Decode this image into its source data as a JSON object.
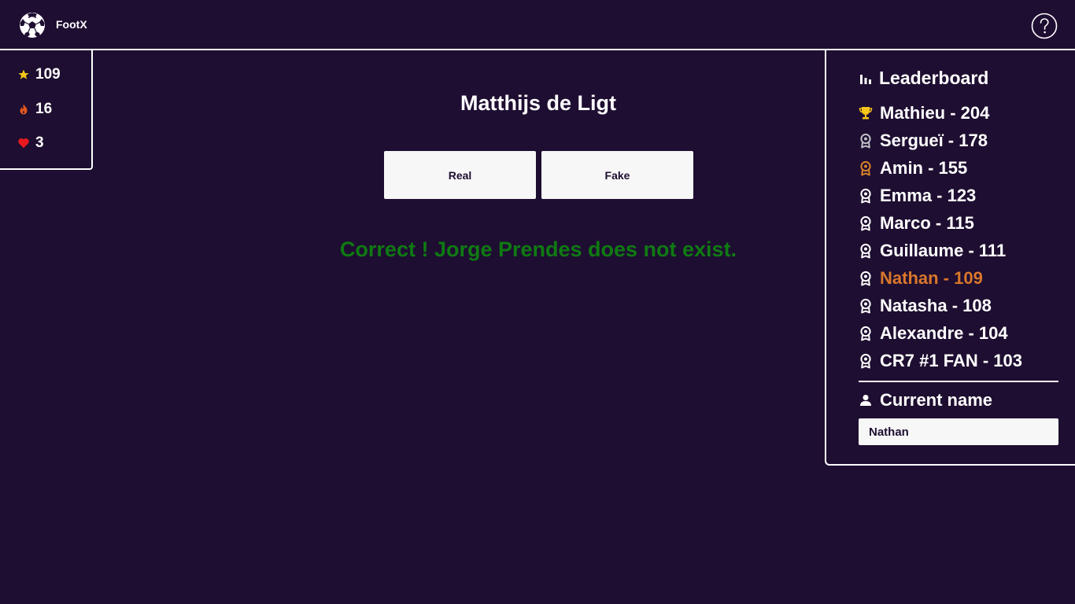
{
  "app": {
    "title": "FootX",
    "logo_icon": "soccer-ball-icon",
    "help_icon": "help-circle-icon"
  },
  "stats": [
    {
      "icon": "star-icon",
      "value": "109",
      "color": "#f5c518"
    },
    {
      "icon": "flame-icon",
      "value": "16",
      "color": "#e2571c"
    },
    {
      "icon": "heart-icon",
      "value": "3",
      "color": "#e8191e"
    }
  ],
  "game": {
    "player_name": "Matthijs de Ligt",
    "real_label": "Real",
    "fake_label": "Fake",
    "result_text": "Correct ! Jorge Prendes does not exist.",
    "result_color": "#0f7a12"
  },
  "leaderboard": {
    "title": "Leaderboard",
    "title_icon": "bar-chart-icon",
    "entries": [
      {
        "text": "Mathieu - 204",
        "icon": "trophy-icon",
        "icon_color": "#f5c518"
      },
      {
        "text": "Sergueï - 178",
        "icon": "medal-icon",
        "icon_color": "#c0c0c8"
      },
      {
        "text": "Amin - 155",
        "icon": "medal-icon",
        "icon_color": "#d9822b"
      },
      {
        "text": "Emma - 123",
        "icon": "medal-icon",
        "icon_color": "#ffffff"
      },
      {
        "text": "Marco - 115",
        "icon": "medal-icon",
        "icon_color": "#ffffff"
      },
      {
        "text": "Guillaume - 111",
        "icon": "medal-icon",
        "icon_color": "#ffffff"
      },
      {
        "text": "Nathan - 109",
        "icon": "medal-icon",
        "icon_color": "#ffffff",
        "highlight_color": "#d9772b"
      },
      {
        "text": "Natasha - 108",
        "icon": "medal-icon",
        "icon_color": "#ffffff"
      },
      {
        "text": "Alexandre - 104",
        "icon": "medal-icon",
        "icon_color": "#ffffff"
      },
      {
        "text": "CR7 #1 FAN - 103",
        "icon": "medal-icon",
        "icon_color": "#ffffff"
      }
    ],
    "current_name_title": "Current name",
    "current_name_icon": "person-icon",
    "current_name_value": "Nathan"
  }
}
